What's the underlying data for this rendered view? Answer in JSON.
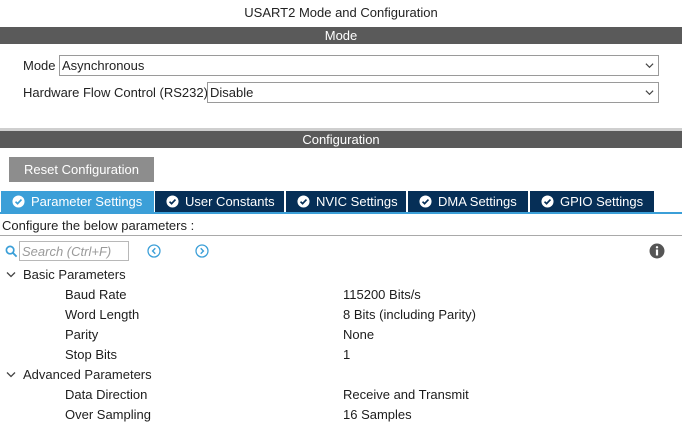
{
  "window": {
    "title": "USART2 Mode and Configuration"
  },
  "mode_section": {
    "header": "Mode",
    "fields": [
      {
        "label": "Mode",
        "value": "Asynchronous"
      },
      {
        "label": "Hardware Flow Control (RS232)",
        "value": "Disable"
      }
    ]
  },
  "config_section": {
    "header": "Configuration",
    "reset_label": "Reset Configuration",
    "tabs": [
      {
        "label": "Parameter Settings",
        "active": true
      },
      {
        "label": "User Constants",
        "active": false
      },
      {
        "label": "NVIC Settings",
        "active": false
      },
      {
        "label": "DMA Settings",
        "active": false
      },
      {
        "label": "GPIO Settings",
        "active": false
      }
    ],
    "hint": "Configure the below parameters :",
    "search_placeholder": "Search (Ctrl+F)"
  },
  "parameters": {
    "basic": {
      "label": "Basic Parameters",
      "items": [
        {
          "name": "Baud Rate",
          "value": "115200 Bits/s"
        },
        {
          "name": "Word Length",
          "value": "8 Bits (including Parity)"
        },
        {
          "name": "Parity",
          "value": "None"
        },
        {
          "name": "Stop Bits",
          "value": "1"
        }
      ]
    },
    "advanced": {
      "label": "Advanced Parameters",
      "items": [
        {
          "name": "Data Direction",
          "value": "Receive and Transmit"
        },
        {
          "name": "Over Sampling",
          "value": "16 Samples"
        }
      ]
    }
  },
  "colors": {
    "section_bar": "#5a5a5a",
    "tab_inactive": "#062f57",
    "tab_active": "#3b9fd8",
    "reset_button": "#8d8d8d",
    "icon_accent": "#3b9fd8"
  },
  "icons": [
    "chevron-down-icon",
    "check-circle-icon",
    "search-icon",
    "chevron-left-circle-icon",
    "chevron-right-circle-icon",
    "info-icon",
    "tree-expand-icon"
  ]
}
